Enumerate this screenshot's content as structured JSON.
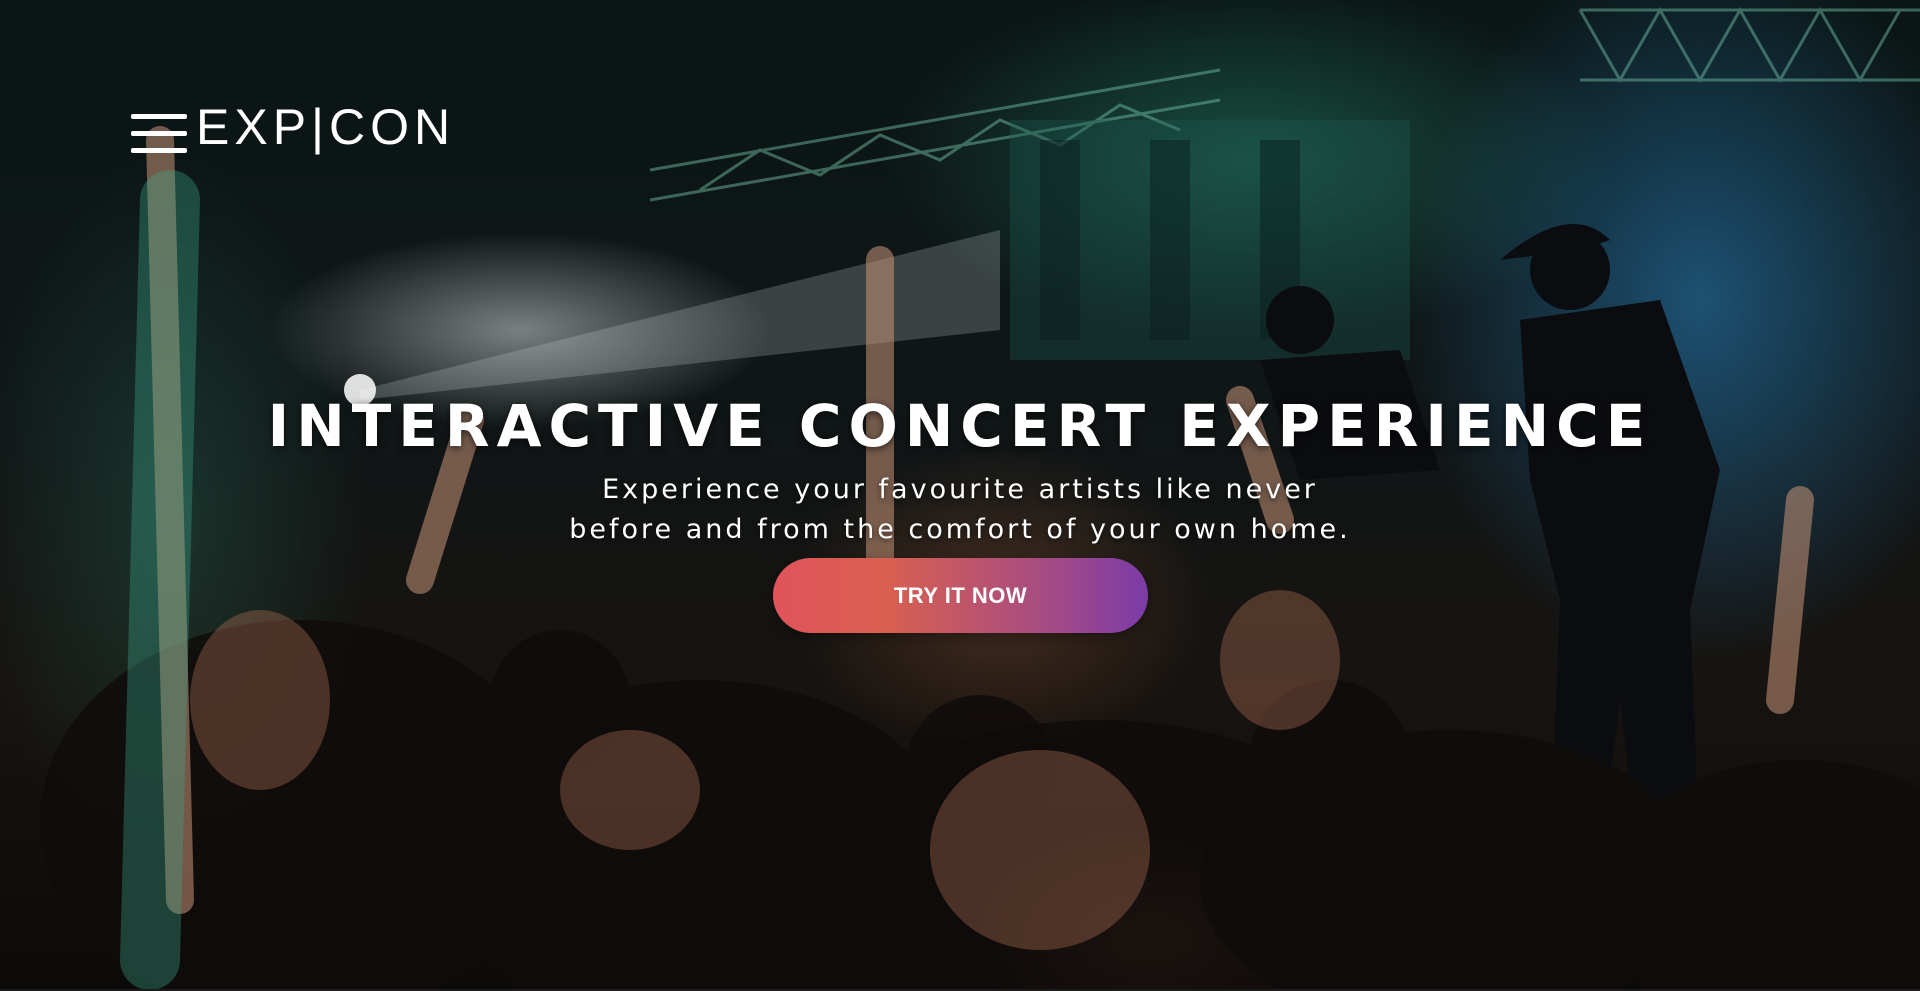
{
  "brand": {
    "logo_text": "EXP|CON"
  },
  "header": {
    "menu_icon": "hamburger-menu-icon"
  },
  "hero": {
    "title": "INTERACTIVE CONCERT EXPERIENCE",
    "subtitle_line1": "Experience your favourite artists like never",
    "subtitle_line2": "before and from the comfort of your own home.",
    "cta_label": "TRY IT NOW",
    "background": "concert-crowd-photo"
  },
  "colors": {
    "cta_gradient_start": "#e0545c",
    "cta_gradient_end": "#7b3ba8",
    "text": "#ffffff"
  }
}
